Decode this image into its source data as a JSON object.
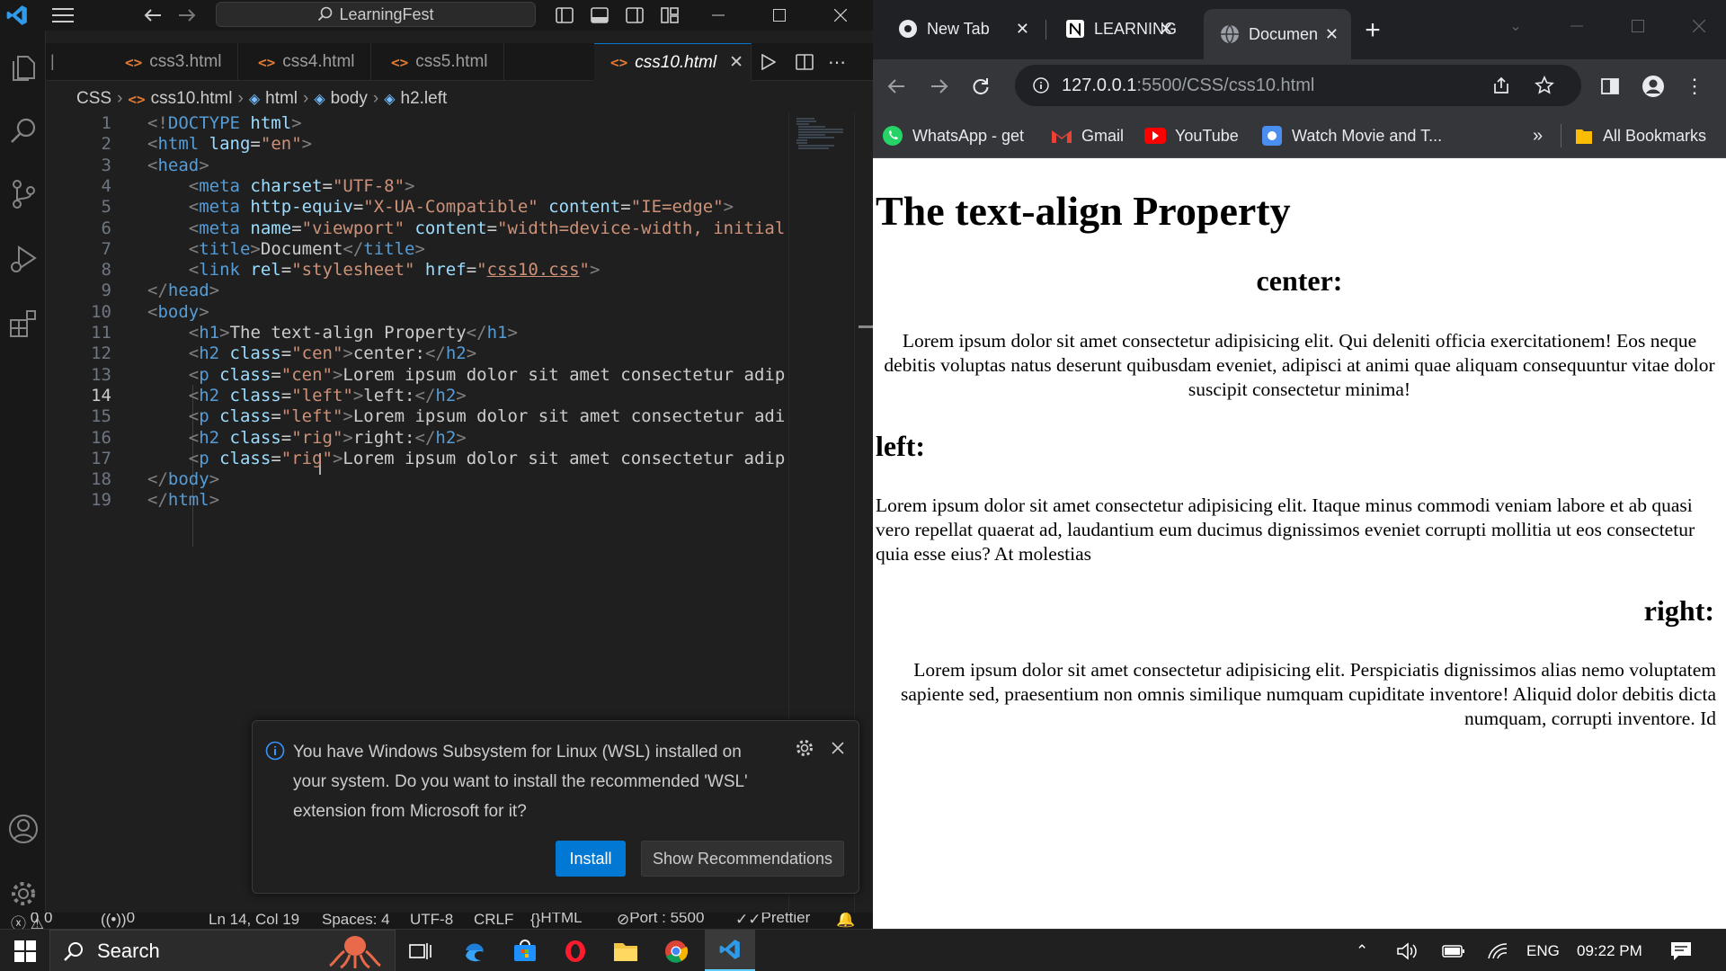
{
  "vscode": {
    "command_center": "LearningFest",
    "tabs": [
      "css3.html",
      "css4.html",
      "css5.html",
      "css10.html"
    ],
    "breadcrumb": [
      "CSS",
      "css10.html",
      "html",
      "body",
      "h2.left"
    ],
    "current_line": 14,
    "code_lines": [
      [
        [
          "t-br",
          "<!"
        ],
        [
          "t-tag",
          "DOCTYPE "
        ],
        [
          "t-at",
          "html"
        ],
        [
          "t-br",
          ">"
        ]
      ],
      [
        [
          "t-br",
          "<"
        ],
        [
          "t-tag",
          "html "
        ],
        [
          "t-at",
          "lang"
        ],
        [
          "t-tx",
          "="
        ],
        [
          "t-st",
          "\"en\""
        ],
        [
          "t-br",
          ">"
        ]
      ],
      [
        [
          "t-br",
          "<"
        ],
        [
          "t-tag",
          "head"
        ],
        [
          "t-br",
          ">"
        ]
      ],
      [
        [
          "t-tx",
          "    "
        ],
        [
          "t-br",
          "<"
        ],
        [
          "t-tag",
          "meta "
        ],
        [
          "t-at",
          "charset"
        ],
        [
          "t-tx",
          "="
        ],
        [
          "t-st",
          "\"UTF-8\""
        ],
        [
          "t-br",
          ">"
        ]
      ],
      [
        [
          "t-tx",
          "    "
        ],
        [
          "t-br",
          "<"
        ],
        [
          "t-tag",
          "meta "
        ],
        [
          "t-at",
          "http-equiv"
        ],
        [
          "t-tx",
          "="
        ],
        [
          "t-st",
          "\"X-UA-Compatible\" "
        ],
        [
          "t-at",
          "content"
        ],
        [
          "t-tx",
          "="
        ],
        [
          "t-st",
          "\"IE=edge\""
        ],
        [
          "t-br",
          ">"
        ]
      ],
      [
        [
          "t-tx",
          "    "
        ],
        [
          "t-br",
          "<"
        ],
        [
          "t-tag",
          "meta "
        ],
        [
          "t-at",
          "name"
        ],
        [
          "t-tx",
          "="
        ],
        [
          "t-st",
          "\"viewport\" "
        ],
        [
          "t-at",
          "content"
        ],
        [
          "t-tx",
          "="
        ],
        [
          "t-st",
          "\"width=device-width, initial"
        ]
      ],
      [
        [
          "t-tx",
          "    "
        ],
        [
          "t-br",
          "<"
        ],
        [
          "t-tag",
          "title"
        ],
        [
          "t-br",
          ">"
        ],
        [
          "t-tx",
          "Document"
        ],
        [
          "t-br",
          "</"
        ],
        [
          "t-tag",
          "title"
        ],
        [
          "t-br",
          ">"
        ]
      ],
      [
        [
          "t-tx",
          "    "
        ],
        [
          "t-br",
          "<"
        ],
        [
          "t-tag",
          "link "
        ],
        [
          "t-at",
          "rel"
        ],
        [
          "t-tx",
          "="
        ],
        [
          "t-st",
          "\"stylesheet\" "
        ],
        [
          "t-at",
          "href"
        ],
        [
          "t-tx",
          "="
        ],
        [
          "t-st",
          "\""
        ],
        [
          "t-st t-u",
          "css10.css"
        ],
        [
          "t-st",
          "\""
        ],
        [
          "t-br",
          ">"
        ]
      ],
      [
        [
          "t-br",
          "</"
        ],
        [
          "t-tag",
          "head"
        ],
        [
          "t-br",
          ">"
        ]
      ],
      [
        [
          "t-br",
          "<"
        ],
        [
          "t-tag",
          "body"
        ],
        [
          "t-br",
          ">"
        ]
      ],
      [
        [
          "t-tx",
          "    "
        ],
        [
          "t-br",
          "<"
        ],
        [
          "t-tag",
          "h1"
        ],
        [
          "t-br",
          ">"
        ],
        [
          "t-tx",
          "The text-align Property"
        ],
        [
          "t-br",
          "</"
        ],
        [
          "t-tag",
          "h1"
        ],
        [
          "t-br",
          ">"
        ]
      ],
      [
        [
          "t-tx",
          "    "
        ],
        [
          "t-br",
          "<"
        ],
        [
          "t-tag",
          "h2 "
        ],
        [
          "t-at",
          "class"
        ],
        [
          "t-tx",
          "="
        ],
        [
          "t-st",
          "\"cen\""
        ],
        [
          "t-br",
          ">"
        ],
        [
          "t-tx",
          "center:"
        ],
        [
          "t-br",
          "</"
        ],
        [
          "t-tag",
          "h2"
        ],
        [
          "t-br",
          ">"
        ]
      ],
      [
        [
          "t-tx",
          "    "
        ],
        [
          "t-br",
          "<"
        ],
        [
          "t-tag",
          "p "
        ],
        [
          "t-at",
          "class"
        ],
        [
          "t-tx",
          "="
        ],
        [
          "t-st",
          "\"cen\""
        ],
        [
          "t-br",
          ">"
        ],
        [
          "t-tx",
          "Lorem ipsum dolor sit amet consectetur adip"
        ]
      ],
      [
        [
          "t-tx",
          "    "
        ],
        [
          "t-br",
          "<"
        ],
        [
          "t-tag",
          "h2 "
        ],
        [
          "t-at",
          "class"
        ],
        [
          "t-tx",
          "="
        ],
        [
          "t-st",
          "\"left\""
        ],
        [
          "t-br",
          ">"
        ],
        [
          "t-tx",
          "left:"
        ],
        [
          "t-br",
          "</"
        ],
        [
          "t-tag",
          "h2"
        ],
        [
          "t-br",
          ">"
        ]
      ],
      [
        [
          "t-tx",
          "    "
        ],
        [
          "t-br",
          "<"
        ],
        [
          "t-tag",
          "p "
        ],
        [
          "t-at",
          "class"
        ],
        [
          "t-tx",
          "="
        ],
        [
          "t-st",
          "\"left\""
        ],
        [
          "t-br",
          ">"
        ],
        [
          "t-tx",
          "Lorem ipsum dolor sit amet consectetur adi"
        ]
      ],
      [
        [
          "t-tx",
          "    "
        ],
        [
          "t-br",
          "<"
        ],
        [
          "t-tag",
          "h2 "
        ],
        [
          "t-at",
          "class"
        ],
        [
          "t-tx",
          "="
        ],
        [
          "t-st",
          "\"rig\""
        ],
        [
          "t-br",
          ">"
        ],
        [
          "t-tx",
          "right:"
        ],
        [
          "t-br",
          "</"
        ],
        [
          "t-tag",
          "h2"
        ],
        [
          "t-br",
          ">"
        ]
      ],
      [
        [
          "t-tx",
          "    "
        ],
        [
          "t-br",
          "<"
        ],
        [
          "t-tag",
          "p "
        ],
        [
          "t-at",
          "class"
        ],
        [
          "t-tx",
          "="
        ],
        [
          "t-st",
          "\"rig\""
        ],
        [
          "t-br",
          ">"
        ],
        [
          "t-tx",
          "Lorem ipsum dolor sit amet consectetur adip"
        ]
      ],
      [
        [
          "t-br",
          "</"
        ],
        [
          "t-tag",
          "body"
        ],
        [
          "t-br",
          ">"
        ]
      ],
      [
        [
          "t-br",
          "</"
        ],
        [
          "t-tag",
          "html"
        ],
        [
          "t-br",
          ">"
        ]
      ]
    ],
    "notification": {
      "message": "You have Windows Subsystem for Linux (WSL) installed on your system. Do you want to install the recommended 'WSL' extension from Microsoft for it?",
      "install_label": "Install",
      "recommend_label": "Show Recommendations"
    },
    "status": {
      "errors": "0",
      "warnings": "0",
      "ports": "0",
      "position": "Ln 14, Col 19",
      "spaces": "Spaces: 4",
      "encoding": "UTF-8",
      "eol": "CRLF",
      "language": "HTML",
      "port": "Port : 5500",
      "prettier": "Prettier"
    }
  },
  "chrome": {
    "tabs": [
      "New Tab",
      "LEARNING",
      "Documen"
    ],
    "url_host": "127.0.0.1",
    "url_path": ":5500/CSS/css10.html",
    "bookmarks": [
      "WhatsApp - get",
      "Gmail",
      "YouTube",
      "Watch Movie and T..."
    ],
    "more_bookmarks": "»",
    "all_bookmarks": "All Bookmarks",
    "page": {
      "h1": "The text-align Property",
      "h2_center": "center:",
      "p_center": "Lorem ipsum dolor sit amet consectetur adipisicing elit. Qui deleniti officia exercitationem! Eos neque debitis voluptas natus deserunt quibusdam eveniet, adipisci at animi quae aliquam consequuntur vitae dolor suscipit consectetur minima!",
      "h2_left": "left:",
      "p_left": "Lorem ipsum dolor sit amet consectetur adipisicing elit. Itaque minus commodi veniam labore et ab quasi vero repellat quaerat ad, laudantium eum ducimus dignissimos eveniet corrupti mollitia ut eos consectetur quia esse eius? At molestias",
      "h2_right": "right:",
      "p_right": "Lorem ipsum dolor sit amet consectetur adipisicing elit. Perspiciatis dignissimos alias nemo voluptatem sapiente sed, praesentium non omnis similique numquam cupiditate inventore! Aliquid dolor debitis dicta numquam, corrupti inventore. Id"
    }
  },
  "taskbar": {
    "search_label": "Search",
    "language": "ENG",
    "time": "09:22 PM"
  },
  "icons": [
    "vscode-logo-icon",
    "menu-icon",
    "back-icon",
    "forward-icon",
    "search-icon",
    "files-icon",
    "source-control-icon",
    "run-debug-icon",
    "extensions-icon",
    "account-icon",
    "settings-icon",
    "info-icon",
    "gear-icon",
    "close-icon",
    "run-icon",
    "split-editor-icon",
    "more-icon",
    "chrome-icon",
    "notion-icon",
    "globe-icon",
    "reload-icon",
    "share-icon",
    "star-icon",
    "sidebar-icon",
    "profile-icon",
    "whatsapp-icon",
    "gmail-icon",
    "youtube-icon",
    "folder-icon",
    "windows-start-icon",
    "task-view-icon",
    "edge-icon",
    "store-icon",
    "opera-icon",
    "file-explorer-icon",
    "bell-icon",
    "wifi-icon",
    "volume-icon",
    "battery-icon",
    "chevron-up-icon"
  ],
  "colors": {
    "accent": "#0078d4",
    "vscode_bg": "#1f1f1f",
    "chrome_bg": "#35363a",
    "tag": "#569cd6",
    "attr": "#9cdcfe",
    "string": "#ce9178"
  }
}
